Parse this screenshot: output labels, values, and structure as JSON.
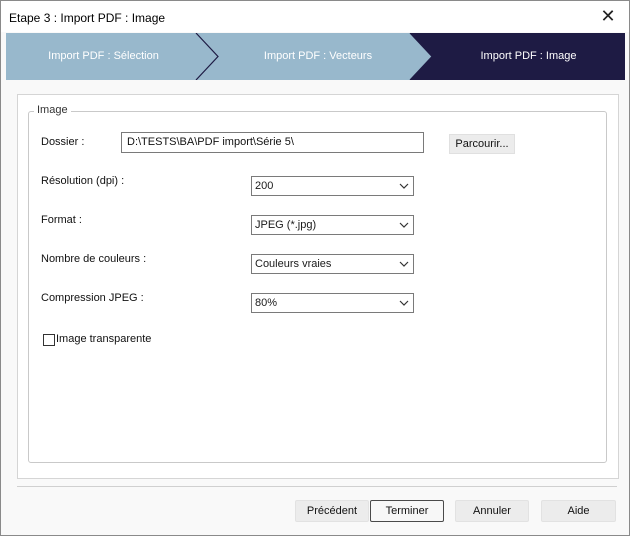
{
  "window": {
    "title": "Etape 3 : Import PDF : Image",
    "close_label": "✕"
  },
  "wizard": {
    "steps": [
      {
        "label": "Import PDF : Sélection",
        "state": "done"
      },
      {
        "label": "Import PDF : Vecteurs",
        "state": "done"
      },
      {
        "label": "Import PDF : Image",
        "state": "active"
      }
    ],
    "colors": {
      "done": "#98b8cc",
      "active": "#1e1b44"
    }
  },
  "group": {
    "title": "Image",
    "folder": {
      "label": "Dossier :",
      "value": "D:\\TESTS\\BA\\PDF import\\Série 5\\",
      "browse_label": "Parcourir..."
    },
    "resolution": {
      "label": "Résolution (dpi) :",
      "value": "200"
    },
    "format": {
      "label": "Format :",
      "value": "JPEG (*.jpg)"
    },
    "colors": {
      "label": "Nombre de couleurs :",
      "value": "Couleurs vraies"
    },
    "compression": {
      "label": "Compression JPEG :",
      "value": "80%"
    },
    "transparent": {
      "label": "Image transparente",
      "checked": false
    }
  },
  "buttons": {
    "previous": "Précédent",
    "finish": "Terminer",
    "cancel": "Annuler",
    "help": "Aide"
  }
}
